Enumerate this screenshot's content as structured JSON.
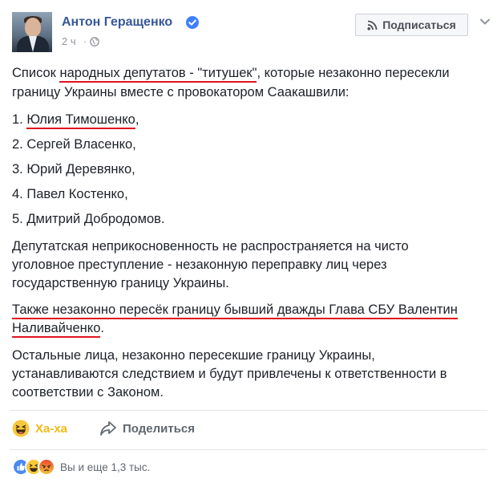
{
  "header": {
    "author_name": "Антон Геращенко",
    "time": "2 ч",
    "dot": "·",
    "subscribe_label": "Подписаться"
  },
  "post": {
    "line1_a": "Список ",
    "line1_b": "народных депутатов - \"титушек\"",
    "line1_c": ", которые незаконно пересекли",
    "line2": "границу Украины вместе с провокатором Саакашвили:",
    "list_item1_num": "1. ",
    "list_item1_name": "Юлия Тимошенко",
    "list_item1_end": ",",
    "list_item2": "2. Сергей Власенко,",
    "list_item3": "3. Юрий Деревянко,",
    "list_item4": "4. Павел Костенко,",
    "list_item5": "5. Дмитрий Добродомов.",
    "immunity_line1": "Депутатская неприкосновенность не распространяется на чисто",
    "immunity_line2": "уголовное преступление - незаконную переправку лиц через",
    "immunity_line3": "государственную границу Украины.",
    "also_line1": "Также незаконно пересёк границу бывший дважды Глава СБУ Валентин",
    "also_line2": "Наливайченко",
    "also_line2_end": ".",
    "rest_line1": "Остальные лица, незаконно пересекшие границу Украины,",
    "rest_line2": "устанавливаются следствием и будут привлечены к ответственности в",
    "rest_line3": "соответствии с Законом."
  },
  "actions": {
    "haha_label": "Ха-ха",
    "share_label": "Поделиться"
  },
  "reactions": {
    "summary": "Вы и еще 1,3 тыс.",
    "icons": [
      "like-icon",
      "haha-icon",
      "angry-icon"
    ]
  },
  "colors": {
    "link": "#365899",
    "underline": "#e0141e",
    "haha": "#f0ba15",
    "verified": "#4080ff"
  }
}
